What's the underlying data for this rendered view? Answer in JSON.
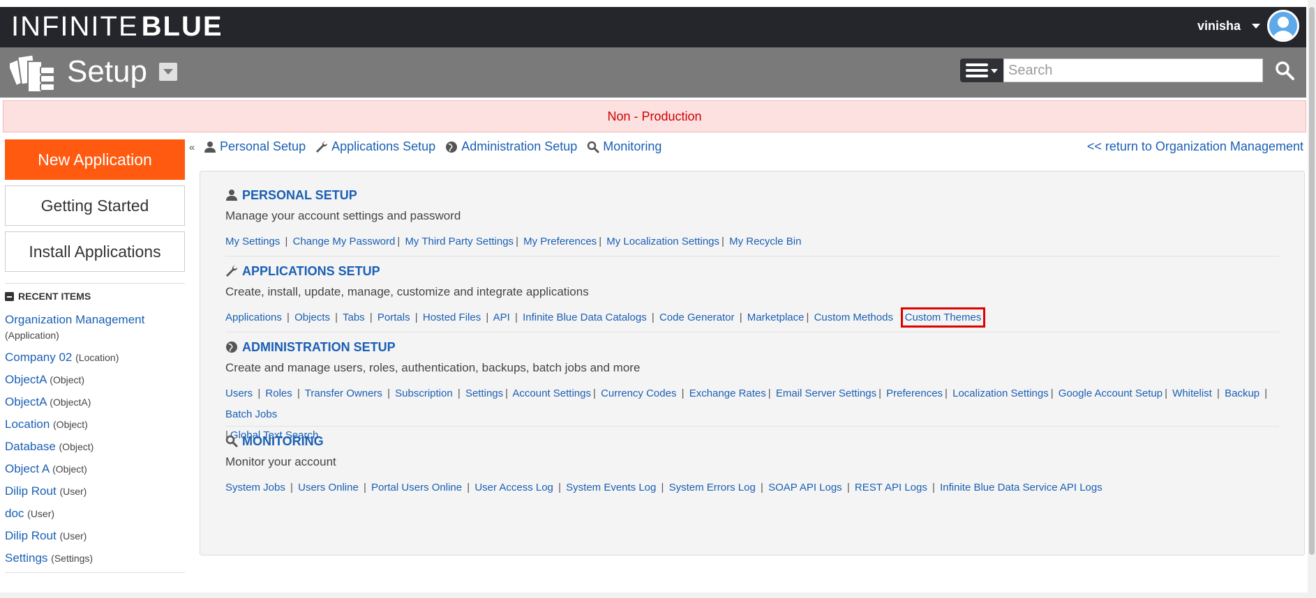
{
  "header": {
    "logo_thin": "INFINITE",
    "logo_bold": "BLUE",
    "username": "vinisha"
  },
  "setup": {
    "title": "Setup",
    "search_placeholder": "Search"
  },
  "banner": "Non - Production",
  "sidebar": {
    "buttons": [
      "New Application",
      "Getting Started",
      "Install Applications"
    ],
    "recent_title": "RECENT ITEMS",
    "recent_items": [
      {
        "name": "Organization Management",
        "type": "(Application)"
      },
      {
        "name": "Company 02",
        "type": "(Location)"
      },
      {
        "name": "ObjectA",
        "type": "(Object)"
      },
      {
        "name": "ObjectA",
        "type": "(ObjectA)"
      },
      {
        "name": "Location",
        "type": "(Object)"
      },
      {
        "name": "Database",
        "type": "(Object)"
      },
      {
        "name": "Object A",
        "type": "(Object)"
      },
      {
        "name": "Dilip Rout",
        "type": "(User)"
      },
      {
        "name": "doc",
        "type": "(User)"
      },
      {
        "name": "Dilip Rout",
        "type": "(User)"
      },
      {
        "name": "Settings",
        "type": "(Settings)"
      }
    ]
  },
  "collapse_label": "«",
  "topnav": {
    "items": [
      "Personal Setup",
      "Applications Setup",
      "Administration Setup",
      "Monitoring"
    ],
    "return_link": "<< return to Organization Management"
  },
  "sections": {
    "personal": {
      "title": "PERSONAL SETUP",
      "desc": "Manage your account settings and password",
      "links": [
        "My Settings",
        "Change My Password",
        "My Third Party Settings",
        "My Preferences",
        "My Localization Settings",
        "My Recycle Bin"
      ]
    },
    "applications": {
      "title": "APPLICATIONS SETUP",
      "desc": "Create, install, update, manage, customize and integrate applications",
      "links": [
        "Applications",
        "Objects",
        "Tabs",
        "Portals",
        "Hosted Files",
        "API",
        "Infinite Blue Data Catalogs",
        "Code Generator",
        "Marketplace",
        "Custom Methods",
        "Custom Themes"
      ]
    },
    "administration": {
      "title": "ADMINISTRATION SETUP",
      "desc": "Create and manage users, roles, authentication, backups, batch jobs and more",
      "links": [
        "Users",
        "Roles",
        "Transfer Owners",
        "Subscription",
        "Settings",
        "Account Settings",
        "Currency Codes",
        "Exchange Rates",
        "Email Server Settings",
        "Preferences",
        "Localization Settings",
        "Google Account Setup",
        "Whitelist",
        "Backup",
        "Batch Jobs",
        "Global Text Search"
      ]
    },
    "monitoring": {
      "title": "MONITORING",
      "desc": "Monitor your account",
      "links": [
        "System Jobs",
        "Users Online",
        "Portal Users Online",
        "User Access Log",
        "System Events Log",
        "System Errors Log",
        "SOAP API Logs",
        "REST API Logs",
        "Infinite Blue Data Service API Logs"
      ]
    }
  }
}
